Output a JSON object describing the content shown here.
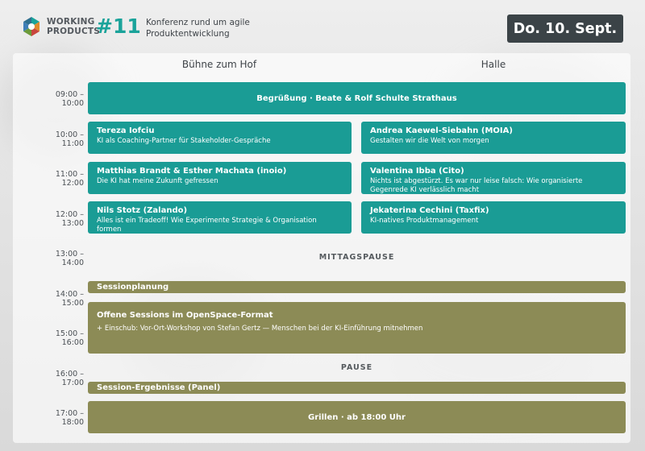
{
  "header": {
    "logo_line1": "WORKING",
    "logo_line2": "PRODUCTS",
    "edition": "#11",
    "tagline_line1": "Konferenz rund um agile",
    "tagline_line2": "Produktentwicklung",
    "date": "Do. 10. Sept."
  },
  "rooms": [
    "Bühne zum Hof",
    "Halle"
  ],
  "times": [
    {
      "start": "09:00 –",
      "end": "10:00"
    },
    {
      "start": "10:00 –",
      "end": "11:00"
    },
    {
      "start": "11:00 –",
      "end": "12:00"
    },
    {
      "start": "12:00 –",
      "end": "13:00"
    },
    {
      "start": "13:00 –",
      "end": "14:00"
    },
    {
      "start": "14:00 –",
      "end": "15:00"
    },
    {
      "start": "15:00 –",
      "end": "16:00"
    },
    {
      "start": "16:00 –",
      "end": "17:00"
    },
    {
      "start": "17:00 –",
      "end": "18:00"
    }
  ],
  "welcome": "Begrüßung · Beate & Rolf Schulte Strathaus",
  "sessions": [
    {
      "speaker": "Tereza Iofciu",
      "title": "KI als Coaching-Partner für Stakeholder-Gespräche"
    },
    {
      "speaker": "Andrea Kaewel-Siebahn (MOIA)",
      "title": "Gestalten wir die Welt von morgen"
    },
    {
      "speaker": "Matthias Brandt & Esther Machata (inoio)",
      "title": "Die KI hat meine Zukunft gefressen"
    },
    {
      "speaker": "Valentina Ibba (Cito)",
      "title": "Nichts ist abgestürzt. Es war nur leise falsch: Wie organisierte Gegenrede KI verlässlich macht"
    },
    {
      "speaker": "Nils Stotz (Zalando)",
      "title": "Alles ist ein Tradeoff! Wie Experimente Strategie & Organisation formen"
    },
    {
      "speaker": "Jekaterina Cechini (Taxfix)",
      "title": "KI-natives Produktmanagement"
    }
  ],
  "lunch": "MITTAGSPAUSE",
  "session_planning": "Sessionplanung",
  "openspace": {
    "title": "Offene Sessions im OpenSpace-Format",
    "note": "+ Einschub: Vor-Ort-Workshop von Stefan Gertz — Menschen bei der KI-Einführung mitnehmen"
  },
  "pause": "PAUSE",
  "panel_results": "Session-Ergebnisse (Panel)",
  "closing": "Grillen · ab 18:00 Uhr",
  "colors": {
    "teal": "#1a9c95",
    "olive": "#8c8b56",
    "badge": "#3b4347",
    "accent": "#1aa39a"
  }
}
